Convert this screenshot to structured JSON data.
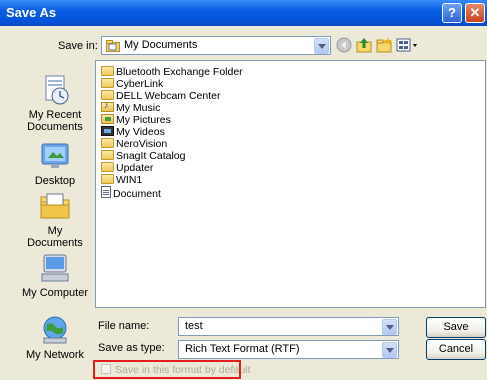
{
  "window": {
    "title": "Save As"
  },
  "toolbar": {
    "save_in_label": "Save in:",
    "save_in_value": "My Documents"
  },
  "places": [
    {
      "label": "My Recent\nDocuments",
      "icon": "recent-documents-icon"
    },
    {
      "label": "Desktop",
      "icon": "desktop-icon"
    },
    {
      "label": "My Documents",
      "icon": "my-documents-icon"
    },
    {
      "label": "My Computer",
      "icon": "my-computer-icon"
    },
    {
      "label": "My Network",
      "icon": "my-network-icon"
    }
  ],
  "files": [
    {
      "name": "Bluetooth Exchange Folder",
      "icon": "folder-icon"
    },
    {
      "name": "CyberLink",
      "icon": "folder-icon"
    },
    {
      "name": "DELL Webcam Center",
      "icon": "folder-icon"
    },
    {
      "name": "My Music",
      "icon": "music-folder-icon"
    },
    {
      "name": "My Pictures",
      "icon": "pictures-folder-icon"
    },
    {
      "name": "My Videos",
      "icon": "videos-folder-icon"
    },
    {
      "name": "NeroVision",
      "icon": "folder-icon"
    },
    {
      "name": "SnagIt Catalog",
      "icon": "folder-icon"
    },
    {
      "name": "Updater",
      "icon": "folder-icon"
    },
    {
      "name": "WIN1",
      "icon": "folder-icon"
    },
    {
      "name": "Document",
      "icon": "document-icon"
    }
  ],
  "form": {
    "file_name_label": "File name:",
    "file_name_value": "test",
    "save_as_type_label": "Save as type:",
    "save_as_type_value": "Rich Text Format (RTF)"
  },
  "buttons": {
    "save": "Save",
    "cancel": "Cancel"
  },
  "checkbox": {
    "label": "Save in this format by default",
    "checked": false,
    "enabled": false
  },
  "colors": {
    "titlebar": "#0a5fe3",
    "highlight": "#e02020"
  }
}
